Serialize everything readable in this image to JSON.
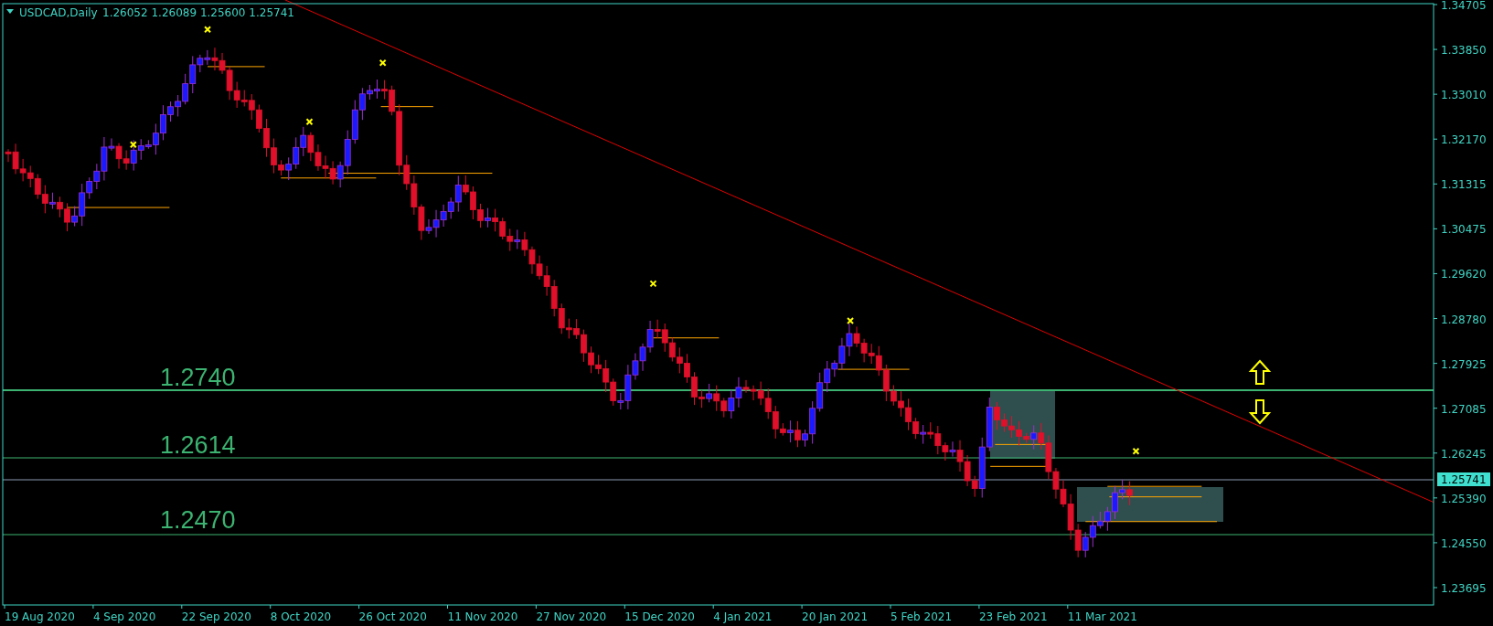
{
  "header": {
    "symbol": "USDCAD,Daily",
    "quote": "1.26052 1.26089 1.25600 1.25741"
  },
  "price_axis": {
    "ticks": [
      "1.34705",
      "1.33850",
      "1.33010",
      "1.32170",
      "1.31315",
      "1.30475",
      "1.29620",
      "1.28780",
      "1.27925",
      "1.27085",
      "1.26245",
      "1.25390",
      "1.24550",
      "1.23695"
    ],
    "current_price": "1.25741"
  },
  "date_axis": {
    "labels": [
      "19 Aug 2020",
      "4 Sep 2020",
      "22 Sep 2020",
      "8 Oct 2020",
      "26 Oct 2020",
      "11 Nov 2020",
      "27 Nov 2020",
      "15 Dec 2020",
      "4 Jan 2021",
      "20 Jan 2021",
      "5 Feb 2021",
      "23 Feb 2021",
      "11 Mar 2021"
    ]
  },
  "level_labels": [
    "1.2740",
    "1.2614",
    "1.2470"
  ]
}
